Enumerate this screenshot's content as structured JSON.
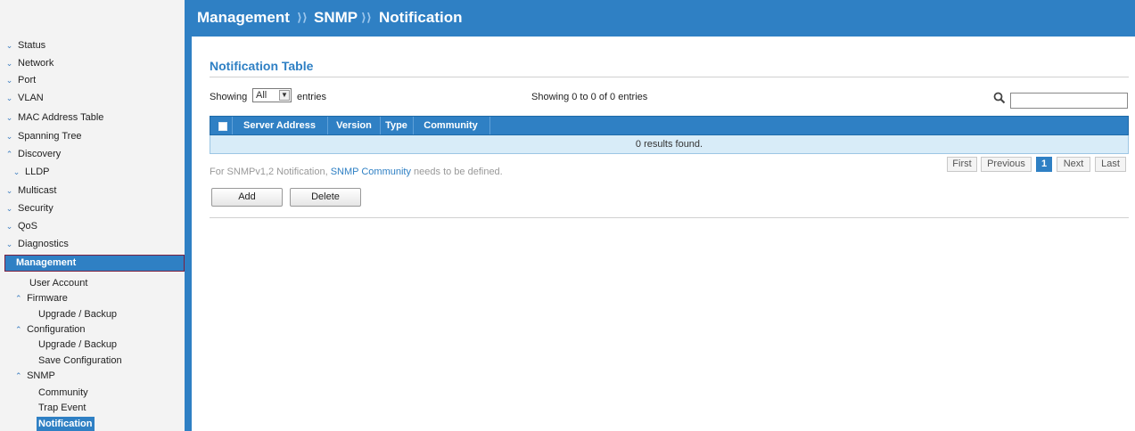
{
  "breadcrumb": [
    "Management",
    "SNMP",
    "Notification"
  ],
  "sidebar": {
    "items": [
      {
        "label": "Status",
        "chevron": "down"
      },
      {
        "label": "Network",
        "chevron": "down"
      },
      {
        "label": "Port",
        "chevron": "down"
      },
      {
        "label": "VLAN",
        "chevron": "down"
      },
      {
        "label": "MAC Address Table",
        "chevron": "down"
      },
      {
        "label": "Spanning Tree",
        "chevron": "down"
      },
      {
        "label": "Discovery",
        "chevron": "up"
      },
      {
        "label": "LLDP",
        "chevron": "down"
      },
      {
        "label": "Multicast",
        "chevron": "down"
      },
      {
        "label": "Security",
        "chevron": "down"
      },
      {
        "label": "QoS",
        "chevron": "down"
      },
      {
        "label": "Diagnostics",
        "chevron": "down"
      }
    ],
    "active_section": "Management",
    "management_children": {
      "user_account": "User Account",
      "firmware": "Firmware",
      "firmware_upgrade": "Upgrade / Backup",
      "configuration": "Configuration",
      "config_upgrade": "Upgrade / Backup",
      "save_configuration": "Save Configuration",
      "snmp": "SNMP",
      "community": "Community",
      "trap_event": "Trap Event",
      "notification": "Notification"
    }
  },
  "main": {
    "section_title": "Notification Table",
    "showing_prefix": "Showing",
    "entries_select_value": "All",
    "entries_suffix": "entries",
    "entries_info": "Showing 0 to 0 of 0 entries",
    "search_value": "",
    "table": {
      "columns": [
        "Server Address",
        "Version",
        "Type",
        "Community"
      ],
      "empty_message": "0 results found."
    },
    "note_prefix": "For SNMPv1,2 Notification, ",
    "note_link": "SNMP Community",
    "note_suffix": " needs to be defined.",
    "pagination": {
      "first": "First",
      "previous": "Previous",
      "current": "1",
      "next": "Next",
      "last": "Last"
    },
    "buttons": {
      "add": "Add",
      "delete": "Delete"
    }
  },
  "colors": {
    "accent": "#2f80c4",
    "sidebar_bg": "#f3f3f3",
    "table_body": "#d8ecf8"
  }
}
